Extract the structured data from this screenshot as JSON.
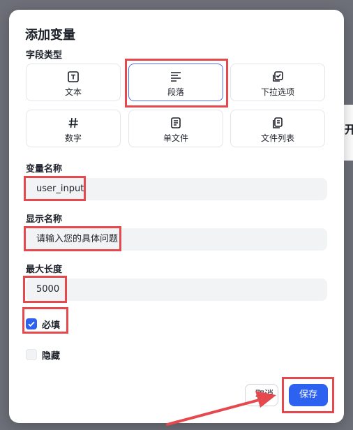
{
  "dialog": {
    "title": "添加变量",
    "field_type_label": "字段类型",
    "types": [
      {
        "label": "文本",
        "icon": "text-icon",
        "selected": false
      },
      {
        "label": "段落",
        "icon": "paragraph-icon",
        "selected": true
      },
      {
        "label": "下拉选项",
        "icon": "select-icon",
        "selected": false
      },
      {
        "label": "数字",
        "icon": "hash-icon",
        "selected": false
      },
      {
        "label": "单文件",
        "icon": "file-icon",
        "selected": false
      },
      {
        "label": "文件列表",
        "icon": "file-list-icon",
        "selected": false
      }
    ],
    "var_name_label": "变量名称",
    "var_name_value": "user_input",
    "display_name_label": "显示名称",
    "display_name_value": "请输入您的具体问题",
    "max_length_label": "最大长度",
    "max_length_value": "5000",
    "required_label": "必填",
    "required_checked": true,
    "hidden_label": "隐藏",
    "hidden_checked": false,
    "cancel_label": "取消",
    "save_label": "保存"
  },
  "background": {
    "partial_text": "开"
  },
  "colors": {
    "accent": "#2c62ef",
    "highlight": "#e5484d",
    "selected_border": "#4f6ef7",
    "input_bg": "#f2f3f5"
  }
}
